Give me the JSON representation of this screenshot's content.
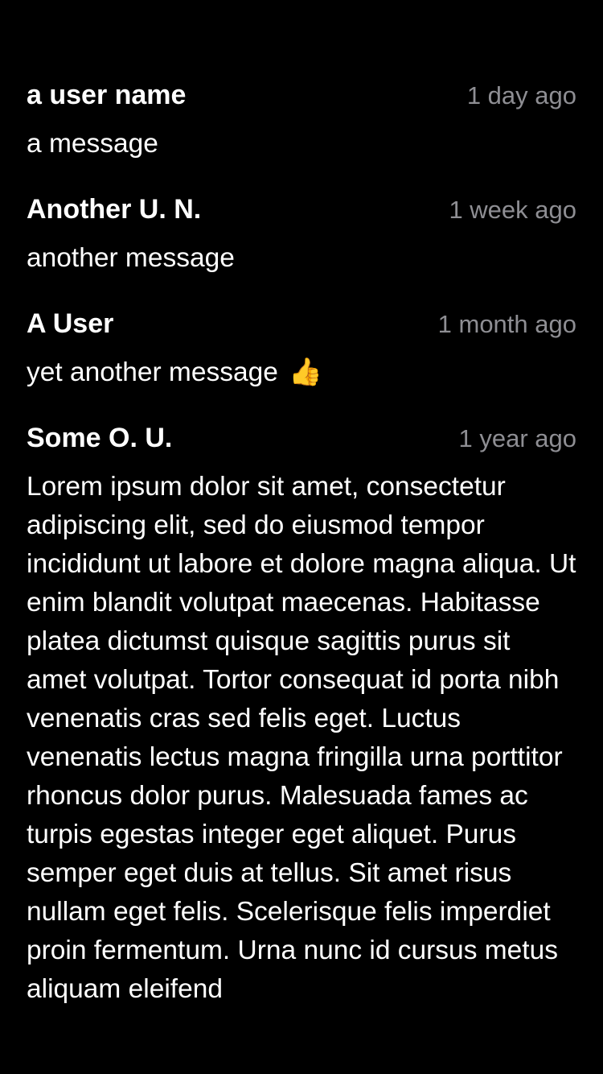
{
  "comments": [
    {
      "user_name": "a user name",
      "timestamp": "1 day ago",
      "message": "a message"
    },
    {
      "user_name": "Another U. N.",
      "timestamp": "1 week ago",
      "message": "another message"
    },
    {
      "user_name": "A User",
      "timestamp": "1 month ago",
      "message": "yet another message",
      "emoji": "👍"
    },
    {
      "user_name": "Some O. U.",
      "timestamp": "1 year ago",
      "message": "Lorem ipsum dolor sit amet, consectetur adipiscing elit, sed do eiusmod tempor incididunt ut labore et dolore magna aliqua. Ut enim blandit volutpat maecenas. Habitasse platea dictumst quisque sagittis purus sit amet volutpat. Tortor consequat id porta nibh venenatis cras sed felis eget. Luctus venenatis lectus magna fringilla urna porttitor rhoncus dolor purus. Malesuada fames ac turpis egestas integer eget aliquet. Purus semper eget duis at tellus. Sit amet risus nullam eget felis. Scelerisque felis imperdiet proin fermentum. Urna nunc id cursus metus aliquam eleifend"
    }
  ],
  "colors": {
    "background": "#000000",
    "primary_text": "#ffffff",
    "secondary_text": "#8e8e93"
  }
}
